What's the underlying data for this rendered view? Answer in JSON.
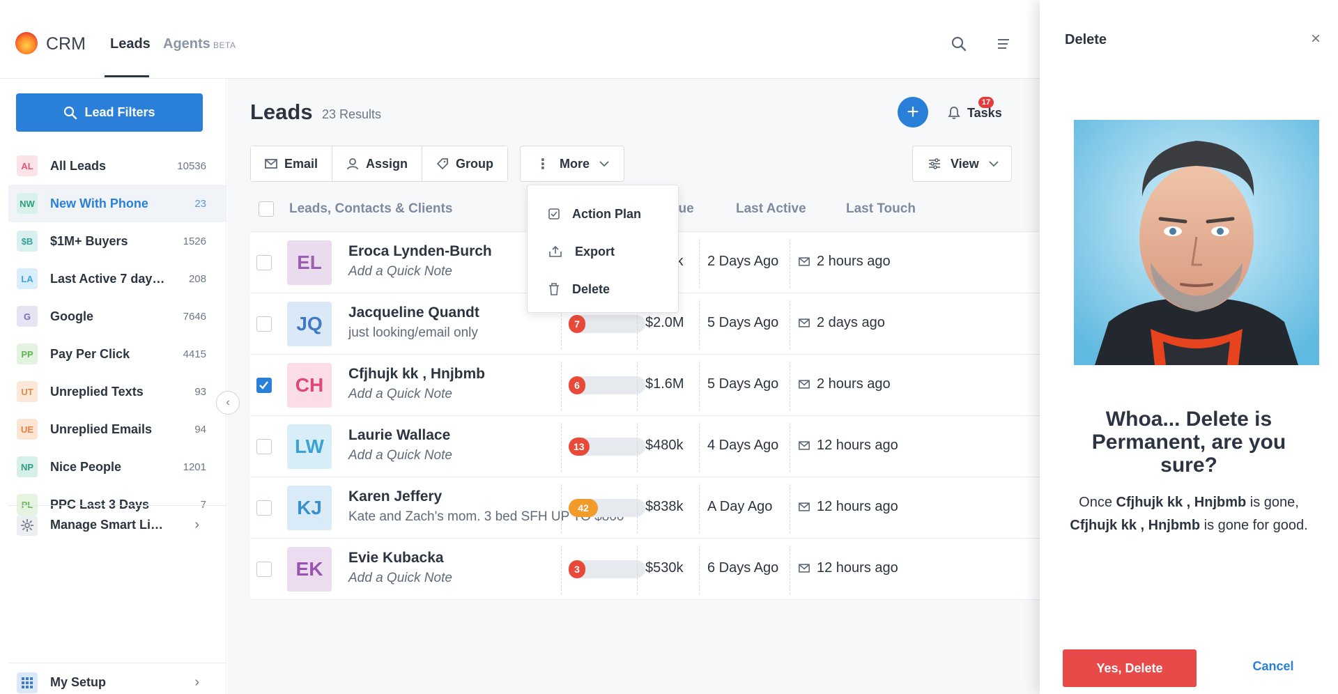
{
  "topbar": {
    "brand": "CRM",
    "nav_leads": "Leads",
    "nav_agents": "Agents",
    "nav_beta": "BETA",
    "search_icon": "search-icon",
    "menu_icon": "menu-icon"
  },
  "sidebar": {
    "lead_filters_label": "Lead Filters",
    "items": [
      {
        "abbr": "AL",
        "label": "All Leads",
        "count": "10536",
        "bg": "#fbe3e8",
        "fg": "#e0557a"
      },
      {
        "abbr": "NW",
        "label": "New With Phone",
        "count": "23",
        "bg": "#d9f1ea",
        "fg": "#2f9d7e"
      },
      {
        "abbr": "$B",
        "label": "$1M+ Buyers",
        "count": "1526",
        "bg": "#d8f0ee",
        "fg": "#35a39a"
      },
      {
        "abbr": "LA",
        "label": "Last Active 7 days...",
        "count": "208",
        "bg": "#d9eefb",
        "fg": "#3ba3dc"
      },
      {
        "abbr": "G",
        "label": "Google",
        "count": "7646",
        "bg": "#e6e3f3",
        "fg": "#7b6fb4"
      },
      {
        "abbr": "PP",
        "label": "Pay Per Click",
        "count": "4415",
        "bg": "#e2f4df",
        "fg": "#65b25b"
      },
      {
        "abbr": "UT",
        "label": "Unreplied Texts",
        "count": "93",
        "bg": "#fce8d9",
        "fg": "#e08a4b"
      },
      {
        "abbr": "UE",
        "label": "Unreplied Emails",
        "count": "94",
        "bg": "#fde5d6",
        "fg": "#e8803f"
      },
      {
        "abbr": "NP",
        "label": "Nice People",
        "count": "1201",
        "bg": "#d6efe9",
        "fg": "#2f9d86"
      },
      {
        "abbr": "PL",
        "label": "PPC Last 3 Days",
        "count": "7",
        "bg": "#e4f4de",
        "fg": "#6fb45f"
      }
    ],
    "manage_smart_lists": "Manage Smart Lists",
    "my_setup": "My Setup"
  },
  "main": {
    "title": "Leads",
    "results": "23 Results",
    "tasks_label": "Tasks",
    "tasks_badge": "17",
    "toolbar": {
      "email": "Email",
      "assign": "Assign",
      "group": "Group",
      "more": "More",
      "view": "View"
    },
    "more_menu": {
      "action_plan": "Action Plan",
      "export": "Export",
      "delete": "Delete"
    },
    "columns": {
      "leads": "Leads, Contacts & Clients",
      "score_partial": "re",
      "value": "Value",
      "last_active": "Last Active",
      "last_touch": "Last Touch"
    },
    "rows": [
      {
        "initials": "EL",
        "name": "Eroca Lynden-Burch",
        "note": "Add a Quick Note",
        "note_italic": true,
        "score": "",
        "score_fraction": 0,
        "score_color": "",
        "value": "$585k",
        "last_active": "2 Days Ago",
        "last_touch": "2 hours ago",
        "checked": false,
        "avatar_bg": "#eadcee",
        "avatar_fg": "#9a5fae"
      },
      {
        "initials": "JQ",
        "name": "Jacqueline Quandt",
        "note": "just looking/email only",
        "note_italic": false,
        "score": "7",
        "score_fraction": 0.07,
        "score_color": "#e84a3a",
        "value": "$2.0M",
        "last_active": "5 Days Ago",
        "last_touch": "2 days ago",
        "checked": false,
        "avatar_bg": "#dbe8f7",
        "avatar_fg": "#3e7ac6"
      },
      {
        "initials": "CH",
        "name": "Cfjhujk kk , Hnjbmb",
        "note": "Add a Quick Note",
        "note_italic": true,
        "score": "6",
        "score_fraction": 0.06,
        "score_color": "#e84a3a",
        "value": "$1.6M",
        "last_active": "5 Days Ago",
        "last_touch": "2 hours ago",
        "checked": true,
        "avatar_bg": "#fbdde6",
        "avatar_fg": "#e0467a"
      },
      {
        "initials": "LW",
        "name": "Laurie Wallace",
        "note": "Add a Quick Note",
        "note_italic": true,
        "score": "13",
        "score_fraction": 0.13,
        "score_color": "#e84a3a",
        "value": "$480k",
        "last_active": "4 Days Ago",
        "last_touch": "12 hours ago",
        "checked": false,
        "avatar_bg": "#d7eef8",
        "avatar_fg": "#3aa2d6"
      },
      {
        "initials": "KJ",
        "name": "Karen Jeffery",
        "note": "Kate and Zach's mom. 3 bed SFH UP TO $800",
        "note_italic": false,
        "score": "42",
        "score_fraction": 0.42,
        "score_color": "#f29a2a",
        "value": "$838k",
        "last_active": "A Day Ago",
        "last_touch": "12 hours ago",
        "checked": false,
        "avatar_bg": "#d9ebf8",
        "avatar_fg": "#3a8fcc"
      },
      {
        "initials": "EK",
        "name": "Evie Kubacka",
        "note": "Add a Quick Note",
        "note_italic": true,
        "score": "3",
        "score_fraction": 0.03,
        "score_color": "#e84a3a",
        "value": "$530k",
        "last_active": "6 Days Ago",
        "last_touch": "12 hours ago",
        "checked": false,
        "avatar_bg": "#ecdcf0",
        "avatar_fg": "#9a52b0"
      }
    ]
  },
  "panel": {
    "title": "Delete",
    "heading": "Whoa... Delete is Permanent, are you sure?",
    "body_part1": "Once",
    "body_name1": "Cfjhujk kk , Hnjbmb",
    "body_part2": "is gone,",
    "body_name2": "Cfjhujk kk , Hnjbmb",
    "body_part3": "is gone for good.",
    "yes_delete": "Yes, Delete",
    "cancel": "Cancel"
  },
  "colors": {
    "accent": "#2a7fd8",
    "danger": "#e84a4a"
  }
}
